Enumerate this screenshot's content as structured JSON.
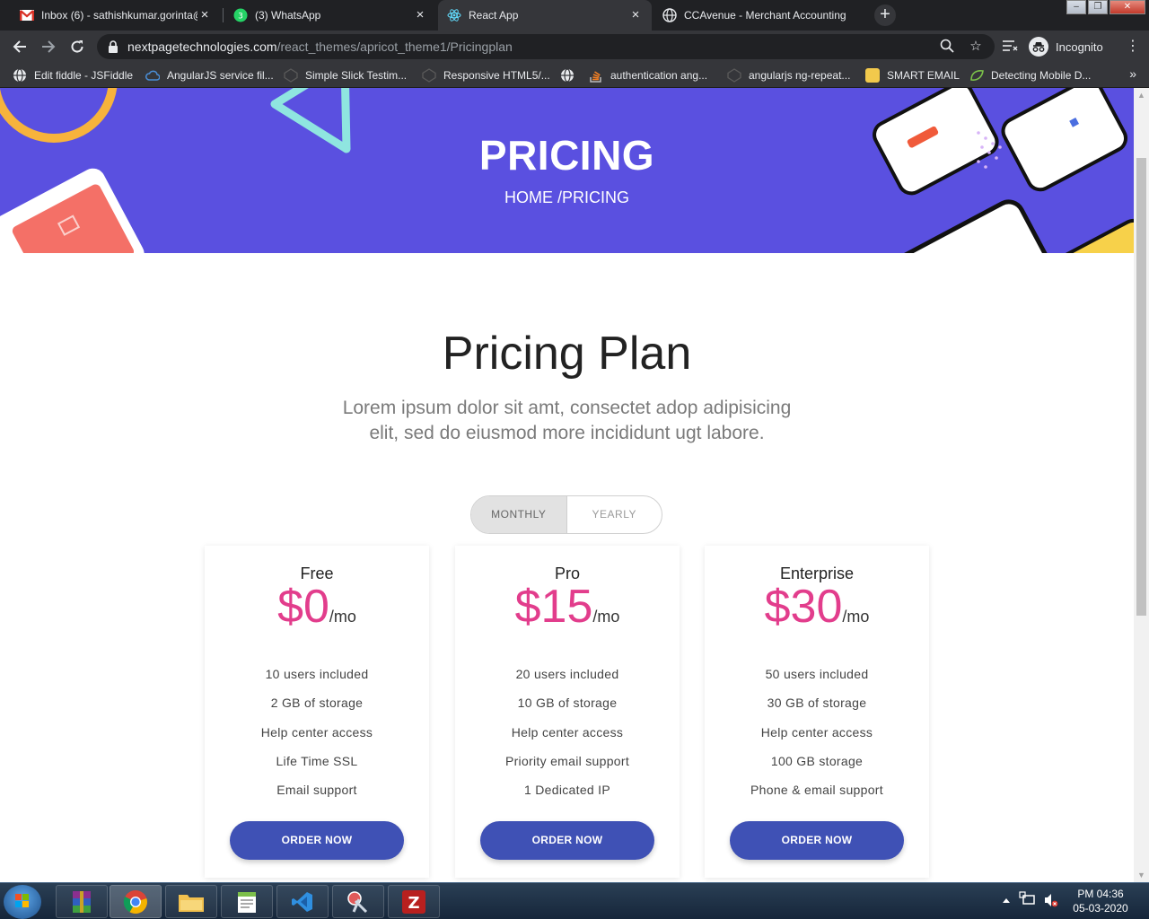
{
  "browser": {
    "tabs": [
      {
        "title": "Inbox (6) - sathishkumar.gorinta@",
        "icon": "gmail-icon",
        "active": false
      },
      {
        "title": "(3) WhatsApp",
        "icon": "whatsapp-icon",
        "active": false
      },
      {
        "title": "React App",
        "icon": "react-icon",
        "active": true
      },
      {
        "title": "CCAvenue - Merchant Accounting",
        "icon": "globe-icon",
        "active": false
      }
    ],
    "url_host": "nextpagetechnologies.com",
    "url_path": "/react_themes/apricot_theme1/Pricingplan",
    "incognito_label": "Incognito",
    "bookmarks": [
      {
        "label": "Edit fiddle - JSFiddle",
        "icon": "jsfiddle-icon",
        "color": "#ffffff"
      },
      {
        "label": "AngularJS service fil...",
        "icon": "cloud-icon",
        "color": "#4a8fd8"
      },
      {
        "label": "Simple Slick Testim...",
        "icon": "codepen-icon",
        "color": "#555555"
      },
      {
        "label": "Responsive HTML5/...",
        "icon": "codepen-icon",
        "color": "#555555"
      },
      {
        "label": "",
        "icon": "globe-icon",
        "color": "#ffffff"
      },
      {
        "label": "authentication ang...",
        "icon": "stackoverflow-icon",
        "color": "#f48024"
      },
      {
        "label": "angularjs ng-repeat...",
        "icon": "codepen-icon",
        "color": "#555555"
      },
      {
        "label": "SMART EMAIL",
        "icon": "smart-email-icon",
        "color": "#f2c94c"
      },
      {
        "label": "Detecting Mobile D...",
        "icon": "leaf-icon",
        "color": "#7cc34a"
      }
    ]
  },
  "hero": {
    "title": "PRICING",
    "breadcrumb": "HOME /PRICING",
    "bg_color": "#5a50e0"
  },
  "pricing": {
    "title": "Pricing Plan",
    "subtitle": "Lorem ipsum dolor sit amt, consectet adop adipisicing elit, sed do eiusmod more incididunt ugt labore.",
    "toggle": {
      "monthly": "MONTHLY",
      "yearly": "YEARLY",
      "selected": "MONTHLY"
    },
    "plans": [
      {
        "name": "Free",
        "price": "$0",
        "period": "/mo",
        "features": [
          "10 users included",
          "2 GB of storage",
          "Help center access",
          "Life Time SSL",
          "Email support"
        ],
        "cta": "ORDER NOW"
      },
      {
        "name": "Pro",
        "price": "$15",
        "period": "/mo",
        "features": [
          "20 users included",
          "10 GB of storage",
          "Help center access",
          "Priority email support",
          "1 Dedicated IP"
        ],
        "cta": "ORDER NOW"
      },
      {
        "name": "Enterprise",
        "price": "$30",
        "period": "/mo",
        "features": [
          "50 users included",
          "30 GB of storage",
          "Help center access",
          "100 GB storage",
          "Phone & email support"
        ],
        "cta": "ORDER NOW"
      }
    ],
    "accent_color": "#e23d8c",
    "button_color": "#3f51b5"
  },
  "taskbar": {
    "apps": [
      "winrar-icon",
      "chrome-icon",
      "file-explorer-icon",
      "notepad-plus-plus-icon",
      "vscode-icon",
      "snipping-tool-icon",
      "filezilla-icon"
    ],
    "time": "PM 04:36",
    "date": "05-03-2020"
  }
}
